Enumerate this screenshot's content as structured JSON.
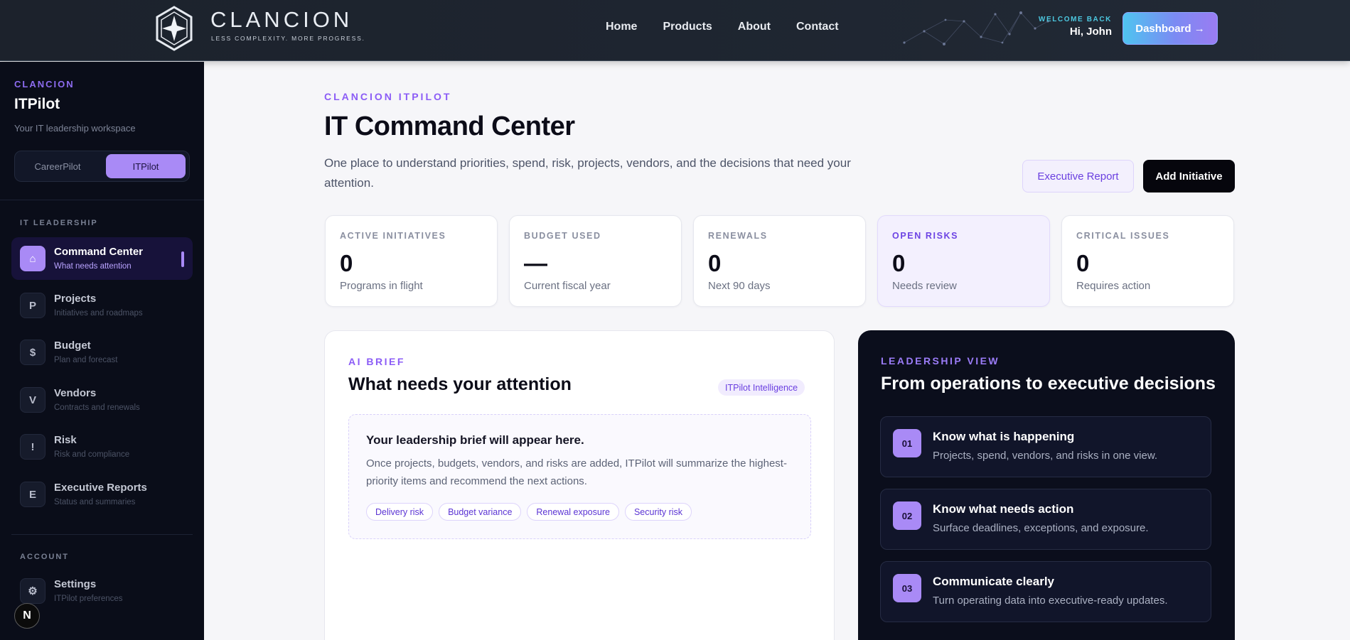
{
  "header": {
    "brand_name": "CLANCION",
    "brand_tagline": "LESS COMPLEXITY. MORE PROGRESS.",
    "nav": [
      "Home",
      "Products",
      "About",
      "Contact"
    ],
    "welcome_label": "WELCOME BACK",
    "welcome_name": "Hi, John",
    "dashboard_button": "Dashboard →"
  },
  "sidebar": {
    "brand": "CLANCION",
    "title": "ITPilot",
    "subtitle": "Your IT leadership workspace",
    "switch": [
      "CareerPilot",
      "ITPilot"
    ],
    "switch_selected": "ITPilot",
    "section_leadership": "IT LEADERSHIP",
    "items": [
      {
        "icon": "⌂",
        "label": "Command Center",
        "desc": "What needs attention"
      },
      {
        "icon": "P",
        "label": "Projects",
        "desc": "Initiatives and roadmaps"
      },
      {
        "icon": "$",
        "label": "Budget",
        "desc": "Plan and forecast"
      },
      {
        "icon": "V",
        "label": "Vendors",
        "desc": "Contracts and renewals"
      },
      {
        "icon": "!",
        "label": "Risk",
        "desc": "Risk and compliance"
      },
      {
        "icon": "E",
        "label": "Executive Reports",
        "desc": "Status and summaries"
      }
    ],
    "section_account": "ACCOUNT",
    "account_items": [
      {
        "icon": "⚙",
        "label": "Settings",
        "desc": "ITPilot preferences"
      }
    ],
    "dev_badge": "N"
  },
  "main": {
    "eyebrow": "CLANCION ITPILOT",
    "title": "IT Command Center",
    "description": "One place to understand priorities, spend, risk, projects, vendors, and the decisions that need your attention.",
    "report_button": "Executive Report",
    "add_button": "Add Initiative",
    "stats": [
      {
        "label": "ACTIVE INITIATIVES",
        "value": "0",
        "sub": "Programs in flight"
      },
      {
        "label": "BUDGET USED",
        "value": "—",
        "sub": "Current fiscal year"
      },
      {
        "label": "RENEWALS",
        "value": "0",
        "sub": "Next 90 days"
      },
      {
        "label": "OPEN RISKS",
        "value": "0",
        "sub": "Needs review"
      },
      {
        "label": "CRITICAL ISSUES",
        "value": "0",
        "sub": "Requires action"
      }
    ],
    "brief": {
      "eyebrow": "AI BRIEF",
      "title": "What needs your attention",
      "badge": "ITPilot Intelligence",
      "placeholder_title": "Your leadership brief will appear here.",
      "placeholder_text": "Once projects, budgets, vendors, and risks are added, ITPilot will summarize the highest-priority items and recommend the next actions.",
      "chips": [
        "Delivery risk",
        "Budget variance",
        "Renewal exposure",
        "Security risk"
      ]
    },
    "leadership": {
      "eyebrow": "LEADERSHIP VIEW",
      "title": "From operations to executive decisions",
      "cards": [
        {
          "num": "01",
          "title": "Know what is happening",
          "text": "Projects, spend, vendors, and risks in one view."
        },
        {
          "num": "02",
          "title": "Know what needs action",
          "text": "Surface deadlines, exceptions, and exposure."
        },
        {
          "num": "03",
          "title": "Communicate clearly",
          "text": "Turn operating data into executive-ready updates."
        }
      ]
    }
  },
  "colors": {
    "accent": "#8b5cf6",
    "accent_soft": "#a98af6",
    "sidebar_bg": "#0a0d19",
    "topbar_bg": "#1e2530",
    "dark_panel": "#0b0e1c"
  }
}
